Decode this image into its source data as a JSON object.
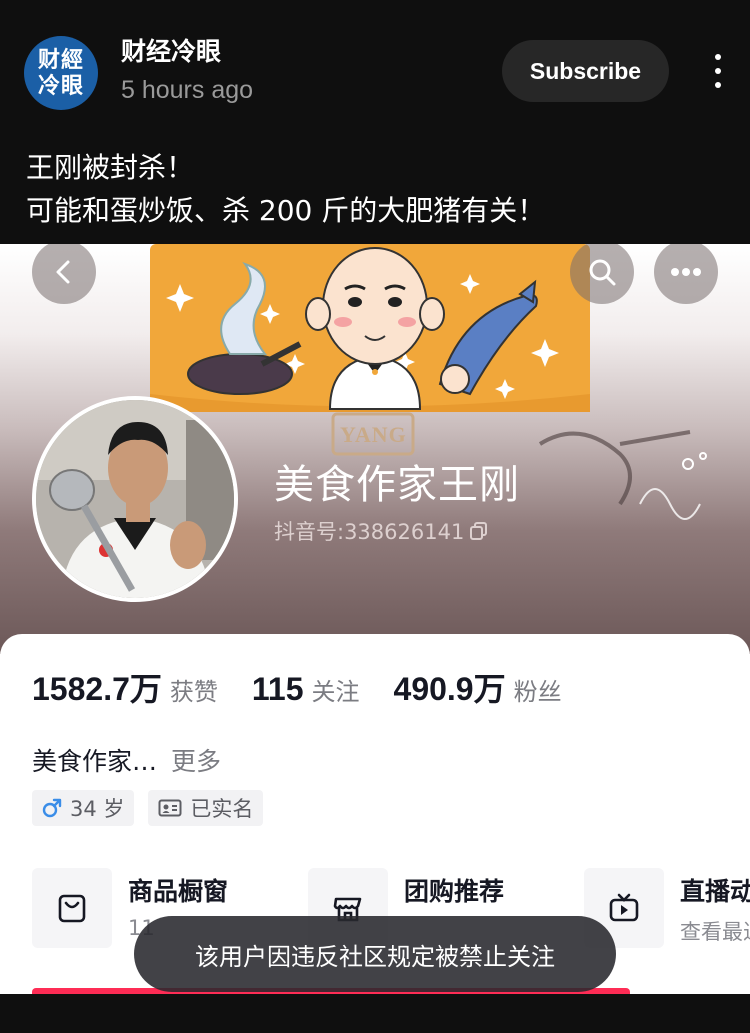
{
  "post": {
    "channel_avatar_line1": "财經",
    "channel_avatar_line2": "冷眼",
    "channel_name": "财经冷眼",
    "time": "5 hours ago",
    "subscribe_label": "Subscribe",
    "text_line1": "王刚被封杀！",
    "text_line2": "可能和蛋炒饭、杀 200 斤的大肥猪有关！"
  },
  "profile": {
    "banner_sign": "YANG",
    "name": "美食作家王刚",
    "id_label": "抖音号:338626141",
    "stats": [
      {
        "value": "1582.7万",
        "label": "获赞"
      },
      {
        "value": "115",
        "label": "关注"
      },
      {
        "value": "490.9万",
        "label": "粉丝"
      }
    ],
    "bio": "美食作家…",
    "bio_more": "更多",
    "tags": [
      {
        "icon": "male-icon",
        "text": "34 岁"
      },
      {
        "icon": "id-card-icon",
        "text": "已实名"
      }
    ],
    "shortcuts": [
      {
        "icon": "shopping-bag-icon",
        "title": "商品橱窗",
        "sub": "11"
      },
      {
        "icon": "store-icon",
        "title": "团购推荐",
        "sub": ""
      },
      {
        "icon": "tv-play-icon",
        "title": "直播动态",
        "sub": "查看最近"
      }
    ],
    "toast": "该用户因违反社区规定被禁止关注"
  },
  "colors": {
    "accent_pink": "#fe2c55",
    "channel_avatar_bg": "#1b5fa6",
    "banner_orange": "#f1a73a",
    "male_blue": "#3a8de8"
  }
}
